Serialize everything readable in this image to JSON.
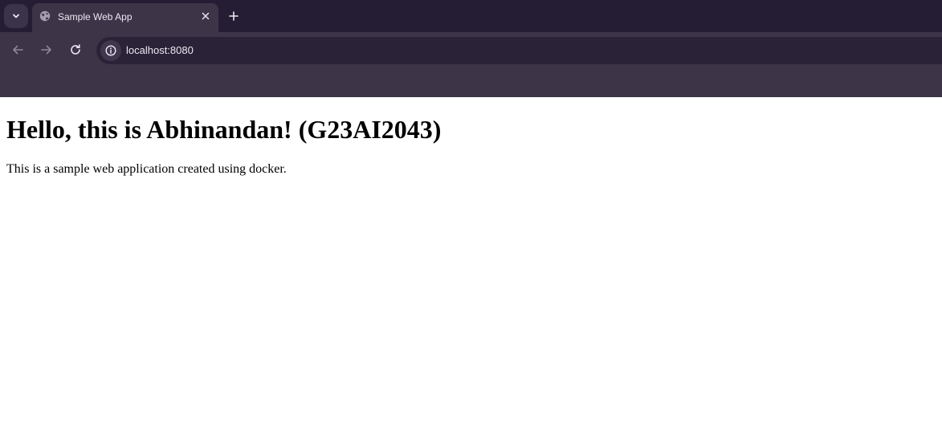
{
  "browser": {
    "tab": {
      "title": "Sample Web App"
    },
    "address_bar": {
      "url": "localhost:8080"
    },
    "icons": {
      "tab_search": "chevron-down-icon",
      "favicon": "globe-icon",
      "close": "close-icon",
      "new_tab": "plus-icon",
      "back": "arrow-left-icon",
      "forward": "arrow-right-icon",
      "reload": "reload-icon",
      "site_info": "info-icon"
    },
    "colors": {
      "tab_strip": "#241d33",
      "toolbar": "#3d3448",
      "omnibox": "#2a2236",
      "text": "#ece8f2"
    }
  },
  "page": {
    "heading": "Hello, this is Abhinandan! (G23AI2043)",
    "paragraph": "This is a sample web application created using docker."
  }
}
